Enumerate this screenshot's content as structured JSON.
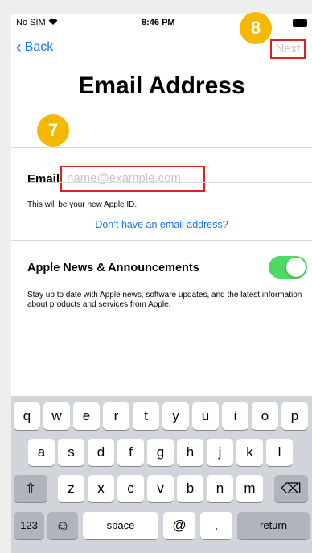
{
  "status": {
    "carrier": "No SIM",
    "time": "8:46 PM"
  },
  "nav": {
    "back_label": "Back",
    "next_label": "Next"
  },
  "badges": {
    "email_step": "7",
    "next_step": "8"
  },
  "page": {
    "title": "Email Address"
  },
  "email": {
    "label": "Email",
    "placeholder": "name@example.com",
    "hint": "This will be your new Apple ID.",
    "link": "Don’t have an email address?"
  },
  "news": {
    "label": "Apple News & Announcements",
    "toggle_on": true,
    "description": "Stay up to date with Apple news, software updates, and the latest information about products and services from Apple."
  },
  "keyboard": {
    "row1": [
      "q",
      "w",
      "e",
      "r",
      "t",
      "y",
      "u",
      "i",
      "o",
      "p"
    ],
    "row2": [
      "a",
      "s",
      "d",
      "f",
      "g",
      "h",
      "j",
      "k",
      "l"
    ],
    "row3": [
      "z",
      "x",
      "c",
      "v",
      "b",
      "n",
      "m"
    ],
    "shift": "⇧",
    "delete": "⌫",
    "numbers": "123",
    "emoji": "☺",
    "space": "space",
    "at": "@",
    "dot": ".",
    "return": "return"
  },
  "colors": {
    "accent": "#1a73e8",
    "highlight": "#e02020",
    "badge": "#f5b800",
    "toggle": "#4cd964"
  }
}
